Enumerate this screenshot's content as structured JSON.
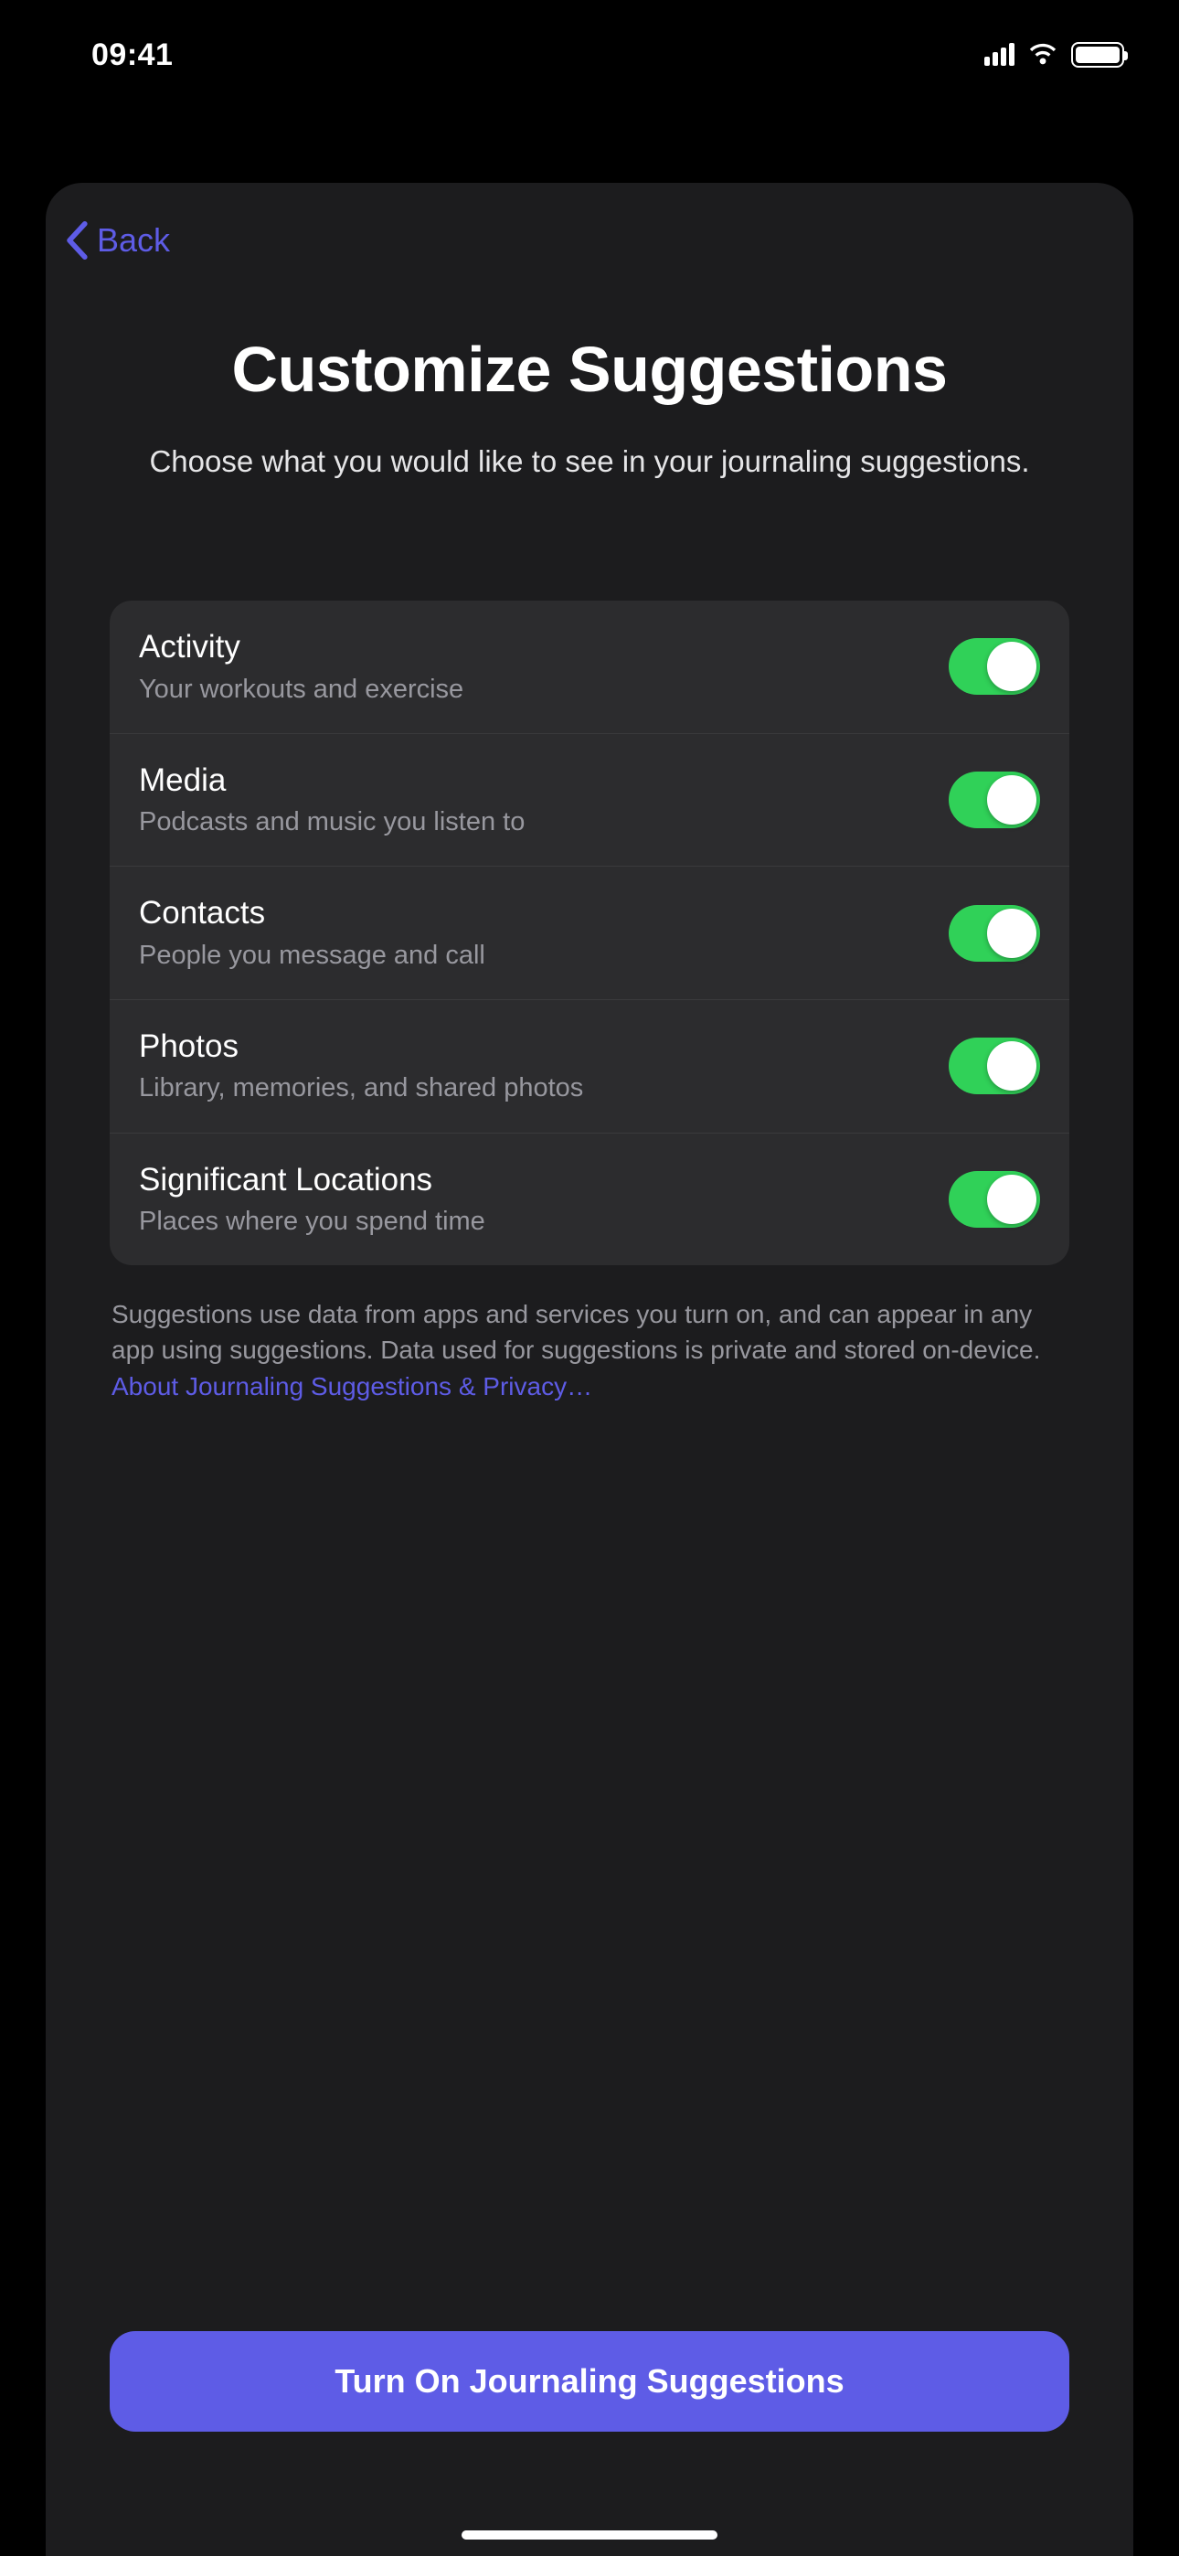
{
  "status": {
    "time": "09:41"
  },
  "nav": {
    "back_label": "Back"
  },
  "header": {
    "title": "Customize Suggestions",
    "subtitle": "Choose what you would like to see in your journaling suggestions."
  },
  "options": [
    {
      "title": "Activity",
      "subtitle": "Your workouts and exercise",
      "on": true
    },
    {
      "title": "Media",
      "subtitle": "Podcasts and music you listen to",
      "on": true
    },
    {
      "title": "Contacts",
      "subtitle": "People you message and call",
      "on": true
    },
    {
      "title": "Photos",
      "subtitle": "Library, memories, and shared photos",
      "on": true
    },
    {
      "title": "Significant Locations",
      "subtitle": "Places where you spend time",
      "on": true
    }
  ],
  "footer": {
    "text": "Suggestions use data from apps and services you turn on, and can appear in any app using suggestions. Data used for suggestions is private and stored on-device. ",
    "link_label": "About Journaling Suggestions & Privacy…"
  },
  "cta_label": "Turn On Journaling Suggestions",
  "colors": {
    "accent": "#5e5ce6",
    "switch_on": "#30d158",
    "sheet_bg": "#1c1c1e",
    "list_bg": "#2c2c2e"
  }
}
